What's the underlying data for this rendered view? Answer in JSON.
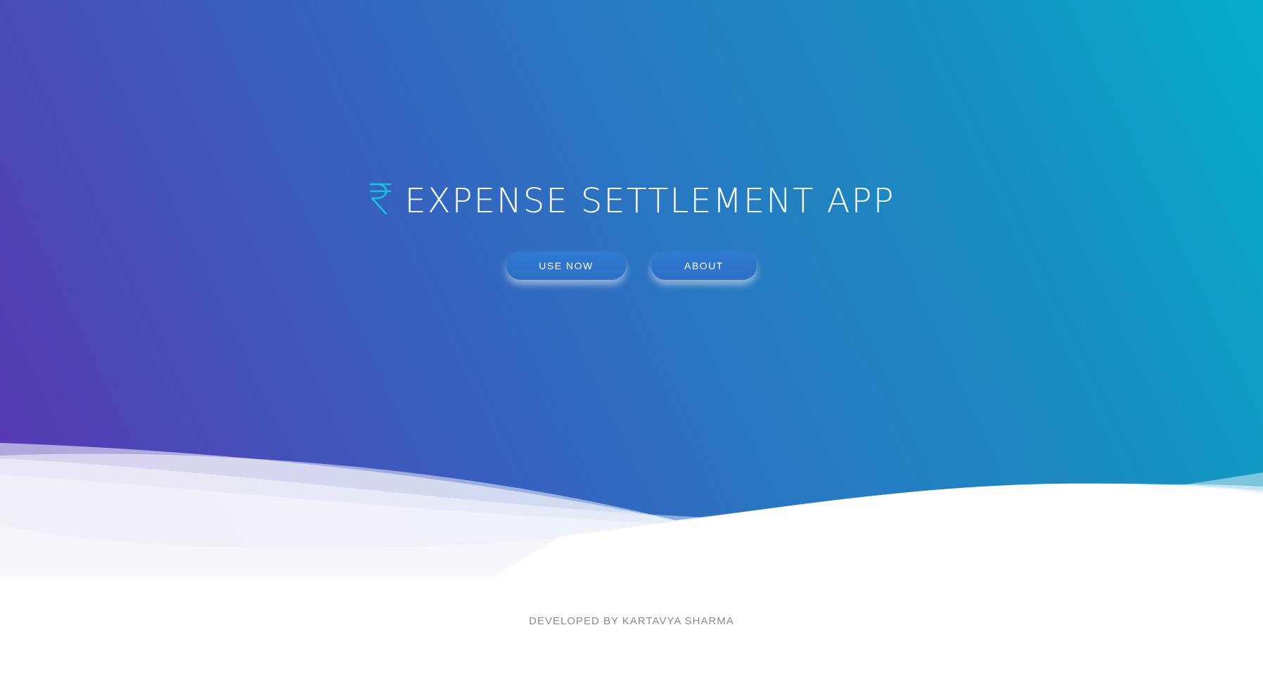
{
  "hero": {
    "title": "EXPENSE SETTLEMENT APP",
    "icon": "rupee-icon",
    "icon_color": "#16c3d8",
    "gradient_colors": [
      "#5a36b2",
      "#2878c2",
      "#05adc8"
    ]
  },
  "actions": {
    "use_now_label": "USE NOW",
    "about_label": "ABOUT"
  },
  "footer": {
    "credit": "DEVELOPED BY KARTAVYA SHARMA"
  }
}
